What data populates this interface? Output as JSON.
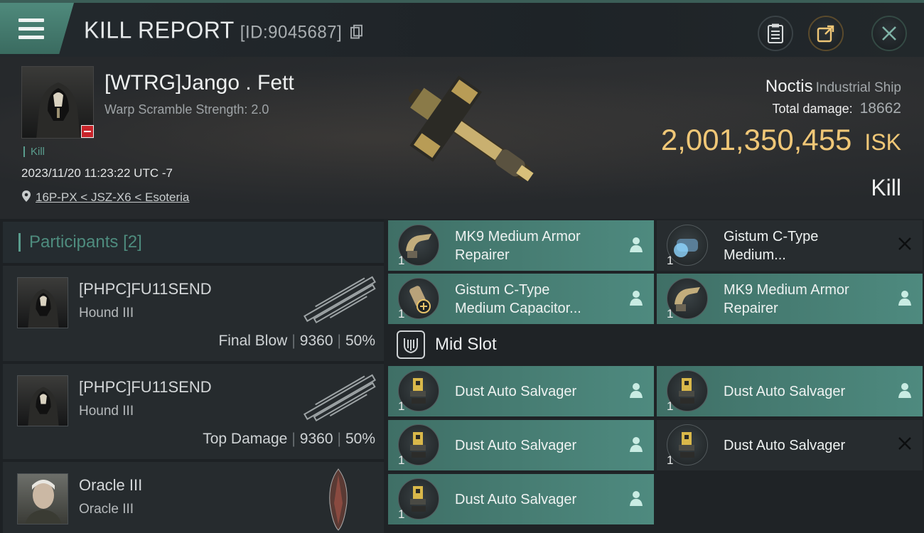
{
  "header": {
    "title": "KILL REPORT",
    "id_label": "[ID:9045687]",
    "menu_icon": "hamburger-menu-icon",
    "buttons": [
      "clipboard-icon",
      "share-icon",
      "close-icon"
    ]
  },
  "victim": {
    "name": "[WTRG]Jango . Fett",
    "warp": "Warp Scramble Strength: 2.0",
    "tag": "Kill",
    "datetime": "2023/11/20 11:23:22 UTC -7",
    "location": "16P-PX < JSZ-X6 < Esoteria",
    "ship_name": "Noctis",
    "ship_class": "Industrial Ship",
    "total_damage_label": "Total damage:",
    "total_damage": "18662",
    "isk_value": "2,001,350,455",
    "isk_unit": "ISK",
    "result": "Kill"
  },
  "participants": {
    "title": "Participants",
    "count": "[2]",
    "rows": [
      {
        "name": "[PHPC]FU11SEND",
        "ship": "Hound III",
        "role": "Final Blow",
        "damage": "9360",
        "percent": "50%"
      },
      {
        "name": "[PHPC]FU11SEND",
        "ship": "Hound III",
        "role": "Top Damage",
        "damage": "9360",
        "percent": "50%"
      },
      {
        "name": "Oracle III",
        "ship": "Oracle III"
      }
    ]
  },
  "fittings": {
    "low": [
      {
        "name": "MK9 Medium Armor Repairer",
        "qty": "1",
        "state": "fitted",
        "icon": "armor-repairer-icon"
      },
      {
        "name": "Gistum C-Type Medium...",
        "qty": "1",
        "state": "destroyed",
        "icon": "capacitor-booster-icon"
      },
      {
        "name": "Gistum C-Type Medium Capacitor...",
        "qty": "1",
        "state": "fitted",
        "icon": "capacitor-icon"
      },
      {
        "name": "MK9 Medium Armor Repairer",
        "qty": "1",
        "state": "fitted",
        "icon": "armor-repairer-icon"
      }
    ],
    "mid_slot_label": "Mid Slot",
    "mid": [
      {
        "name": "Dust Auto Salvager",
        "qty": "1",
        "state": "fitted",
        "icon": "salvager-icon"
      },
      {
        "name": "Dust Auto Salvager",
        "qty": "1",
        "state": "fitted",
        "icon": "salvager-icon"
      },
      {
        "name": "Dust Auto Salvager",
        "qty": "1",
        "state": "fitted",
        "icon": "salvager-icon"
      },
      {
        "name": "Dust Auto Salvager",
        "qty": "1",
        "state": "destroyed",
        "icon": "salvager-icon"
      },
      {
        "name": "Dust Auto Salvager",
        "qty": "1",
        "state": "fitted",
        "icon": "salvager-icon"
      }
    ]
  },
  "colors": {
    "accent": "#4e8a7f",
    "isk_gold": "#f0c777",
    "badge_red": "#c8242a"
  }
}
